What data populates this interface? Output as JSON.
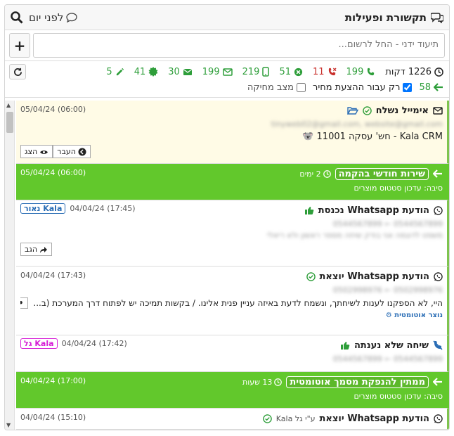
{
  "header": {
    "title": "תקשורת ופעילות",
    "ago": "לפני יום"
  },
  "note": {
    "placeholder": "תיעוד ידני - החל לרשום..."
  },
  "stats": {
    "minutes": "1226 דקות",
    "calls": "199",
    "missed": "11",
    "rejected": "51",
    "mobile": "219",
    "emails": "199",
    "envelopes": "30",
    "seals": "41",
    "notes": "5",
    "forward": "58",
    "only_label": "רק עבור ההצעת מחיר",
    "deleted_label": "מצב מחיקה"
  },
  "items": [
    {
      "title": "אימייל נשלח",
      "date": "05/04/24 (06:00)",
      "blur1": "tinyweb02@gmail.com, website@gmail.com",
      "line": "Kala CRM - חש' עסקה 11001",
      "btn_move": "העבר",
      "btn_show": "הצג"
    },
    {
      "title": "שירות חודשי בהקמה",
      "sub": "2 ימים",
      "date": "05/04/24 (06:00)",
      "reason": "סיבה: עדכון סטטוס מוצרים"
    },
    {
      "title": "הודעת Whatsapp נכנסת",
      "badge": "נאור Kala",
      "date": "04/04/24 (17:45)",
      "blur1": "0544567899 ← 0544567899",
      "blur2": "משפט לדוגמה אני בודק שיחה מספר ראשון ולא ריאלי",
      "btn_reply": "הגב"
    },
    {
      "title": "הודעת Whatsapp יוצאת",
      "date": "04/04/24 (17:43)",
      "blur1": "0502998976 ← 0502998976",
      "line": "היי, לא הספקנו לענות לשיחתך, ונשמח לדעת באיזה עניין פנית אלינו. / בקשות תמיכה יש לפתוח דרך המערכת (ב...",
      "auto": "נוצר אוטומטית"
    },
    {
      "title": "שיחה שלא נענתה",
      "badge": "גל Kala",
      "date": "04/04/24 (17:42)",
      "blur1": "0544567899 ← 0544567899"
    },
    {
      "title": "ממתין להנפקת מסמך אוטומטית",
      "sub": "13 שעות",
      "date": "04/04/24 (17:00)",
      "reason": "סיבה: עדכון סטטוס מוצרים"
    },
    {
      "title": "הודעת Whatsapp יוצאת",
      "by": "ע\"י גל Kala",
      "date": "04/04/24 (15:10)"
    }
  ],
  "colors": {
    "green": "#62c82c",
    "accent_green": "#2e9e3a",
    "red": "#c9302c",
    "blue_badge": "#2a6db5",
    "pink_badge": "#d61fd6"
  }
}
